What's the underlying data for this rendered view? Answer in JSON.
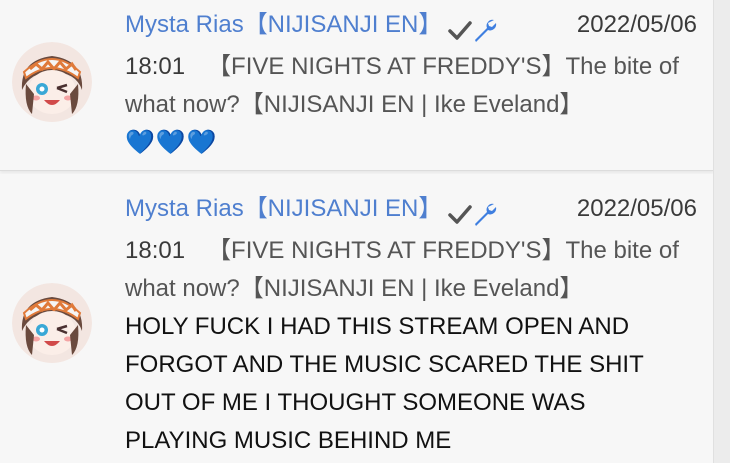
{
  "comments": [
    {
      "author": "Mysta Rias",
      "affiliation": "【NIJISANJI EN】",
      "date": "2022/05/06",
      "time": "18:01",
      "video_title_line1": "【FIVE NIGHTS AT FREDDY'S】The bite of",
      "video_title_line2": "what now?【NIJISANJI EN | Ike Eveland】",
      "message": "💙💙💙"
    },
    {
      "author": "Mysta Rias",
      "affiliation": "【NIJISANJI EN】",
      "date": "2022/05/06",
      "time": "18:01",
      "video_title_line1": "【FIVE NIGHTS AT FREDDY'S】The bite of",
      "video_title_line2": "what now?【NIJISANJI EN | Ike Eveland】",
      "message_lines": [
        "HOLY FUCK I HAD THIS STREAM OPEN AND",
        "FORGOT AND THE MUSIC SCARED THE SHIT",
        "OUT OF ME I THOUGHT SOMEONE WAS",
        "PLAYING MUSIC BEHIND ME"
      ]
    }
  ],
  "icons": {
    "verified": "checkmark-icon",
    "moderator": "wrench-icon"
  },
  "colors": {
    "author": "#4f7fcf",
    "badge": "#555555",
    "wrench": "#3f7fe0"
  }
}
